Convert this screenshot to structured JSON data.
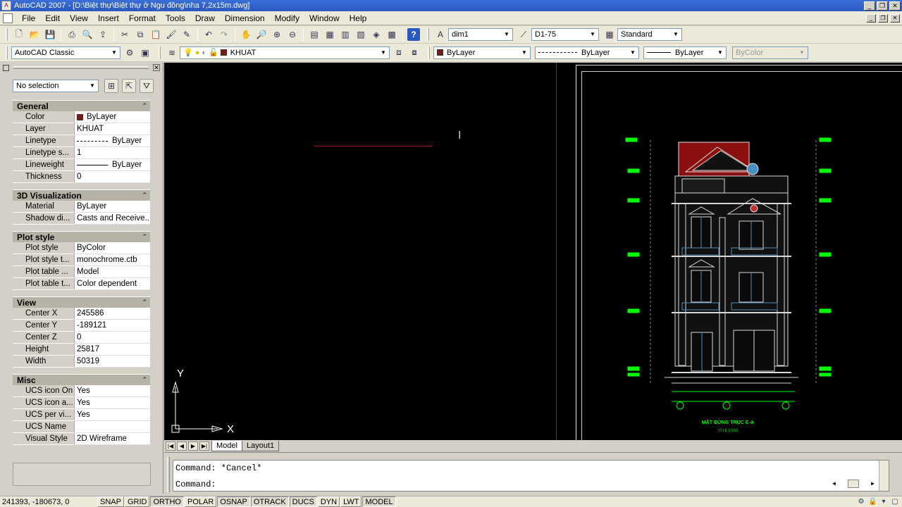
{
  "window": {
    "title": "AutoCAD 2007 - [D:\\Biệt thự\\Biệt thự ở Ngu đồng\\nha 7,2x15m.dwg]",
    "app_icon_text": "A"
  },
  "menu": [
    "File",
    "Edit",
    "View",
    "Insert",
    "Format",
    "Tools",
    "Draw",
    "Dimension",
    "Modify",
    "Window",
    "Help"
  ],
  "toolbar1": {
    "dimstyle": "dim1",
    "textstyle": "D1-75",
    "tablestyle": "Standard"
  },
  "toolbar2": {
    "workspace": "AutoCAD Classic",
    "layer": "KHUAT",
    "color": "ByLayer",
    "linetype": "ByLayer",
    "lineweight": "ByLayer",
    "plotstyle": "ByColor"
  },
  "colors": {
    "drawing_bg": "#000000",
    "layer_color": "#7a1a10",
    "border_line": "#c01010",
    "dim_green": "#00ff00"
  },
  "properties": {
    "selection": "No selection",
    "sections": [
      {
        "name": "General",
        "rows": [
          {
            "label": "Color",
            "value": "ByLayer",
            "kind": "color"
          },
          {
            "label": "Layer",
            "value": "KHUAT"
          },
          {
            "label": "Linetype",
            "value": "ByLayer",
            "kind": "linetype"
          },
          {
            "label": "Linetype s...",
            "value": "1"
          },
          {
            "label": "Lineweight",
            "value": "ByLayer",
            "kind": "lineweight"
          },
          {
            "label": "Thickness",
            "value": "0"
          }
        ]
      },
      {
        "name": "3D Visualization",
        "rows": [
          {
            "label": "Material",
            "value": "ByLayer"
          },
          {
            "label": "Shadow di...",
            "value": "Casts and Receive..."
          }
        ]
      },
      {
        "name": "Plot style",
        "rows": [
          {
            "label": "Plot style",
            "value": "ByColor"
          },
          {
            "label": "Plot style t...",
            "value": "monochrome.ctb"
          },
          {
            "label": "Plot table ...",
            "value": "Model"
          },
          {
            "label": "Plot table t...",
            "value": "Color dependent"
          }
        ]
      },
      {
        "name": "View",
        "rows": [
          {
            "label": "Center X",
            "value": "245586"
          },
          {
            "label": "Center Y",
            "value": "-189121"
          },
          {
            "label": "Center Z",
            "value": "0"
          },
          {
            "label": "Height",
            "value": "25817"
          },
          {
            "label": "Width",
            "value": "50319"
          }
        ]
      },
      {
        "name": "Misc",
        "rows": [
          {
            "label": "UCS icon On",
            "value": "Yes"
          },
          {
            "label": "UCS icon a...",
            "value": "Yes"
          },
          {
            "label": "UCS per vi...",
            "value": "Yes"
          },
          {
            "label": "UCS Name",
            "value": ""
          },
          {
            "label": "Visual Style",
            "value": "2D Wireframe"
          }
        ]
      }
    ]
  },
  "drawing": {
    "ucs_x": "X",
    "ucs_y": "Y",
    "elevation_title": "MẶT ĐỨNG TRỤC C-A",
    "elevation_subtitle": "(TỈ LỆ 1/100)"
  },
  "tabs": [
    "Model",
    "Layout1"
  ],
  "command": {
    "history": "Command: *Cancel*",
    "prompt": "Command:"
  },
  "status": {
    "coords": "241393, -180673, 0",
    "buttons": [
      {
        "label": "SNAP",
        "on": false
      },
      {
        "label": "GRID",
        "on": false
      },
      {
        "label": "ORTHO",
        "on": true
      },
      {
        "label": "POLAR",
        "on": false
      },
      {
        "label": "OSNAP",
        "on": true
      },
      {
        "label": "OTRACK",
        "on": true
      },
      {
        "label": "DUCS",
        "on": true
      },
      {
        "label": "DYN",
        "on": false
      },
      {
        "label": "LWT",
        "on": false
      },
      {
        "label": "MODEL",
        "on": true
      }
    ]
  }
}
